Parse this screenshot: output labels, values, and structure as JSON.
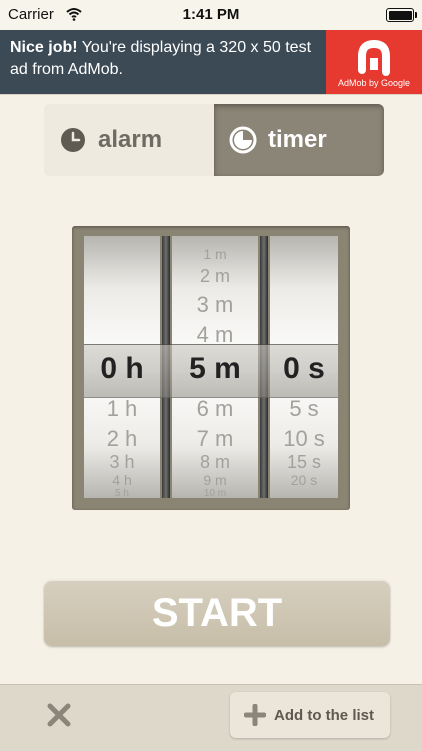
{
  "status_bar": {
    "carrier": "Carrier",
    "time": "1:41 PM"
  },
  "ad": {
    "headline": "Nice job!",
    "body": " You're displaying a 320 x 50 test ad from AdMob.",
    "logo_label": "AdMob by Google",
    "color": "#e6392f"
  },
  "mode_tabs": [
    {
      "label": "alarm",
      "icon": "clock-icon",
      "selected": false
    },
    {
      "label": "timer",
      "icon": "timer-icon",
      "selected": true
    }
  ],
  "picker": {
    "hours": {
      "above": [],
      "selected": "0 h",
      "below": [
        "1 h",
        "2 h",
        "3 h",
        "4 h",
        "5 h"
      ]
    },
    "minutes": {
      "above": [
        "1 m",
        "2 m",
        "3 m",
        "4 m"
      ],
      "selected": "5 m",
      "below": [
        "6 m",
        "7 m",
        "8 m",
        "9 m",
        "10 m"
      ]
    },
    "seconds": {
      "above": [],
      "selected": "0 s",
      "below": [
        "5 s",
        "10 s",
        "15 s",
        "20 s"
      ]
    }
  },
  "start_label": "START",
  "bottom": {
    "add_label": "Add to the list"
  }
}
